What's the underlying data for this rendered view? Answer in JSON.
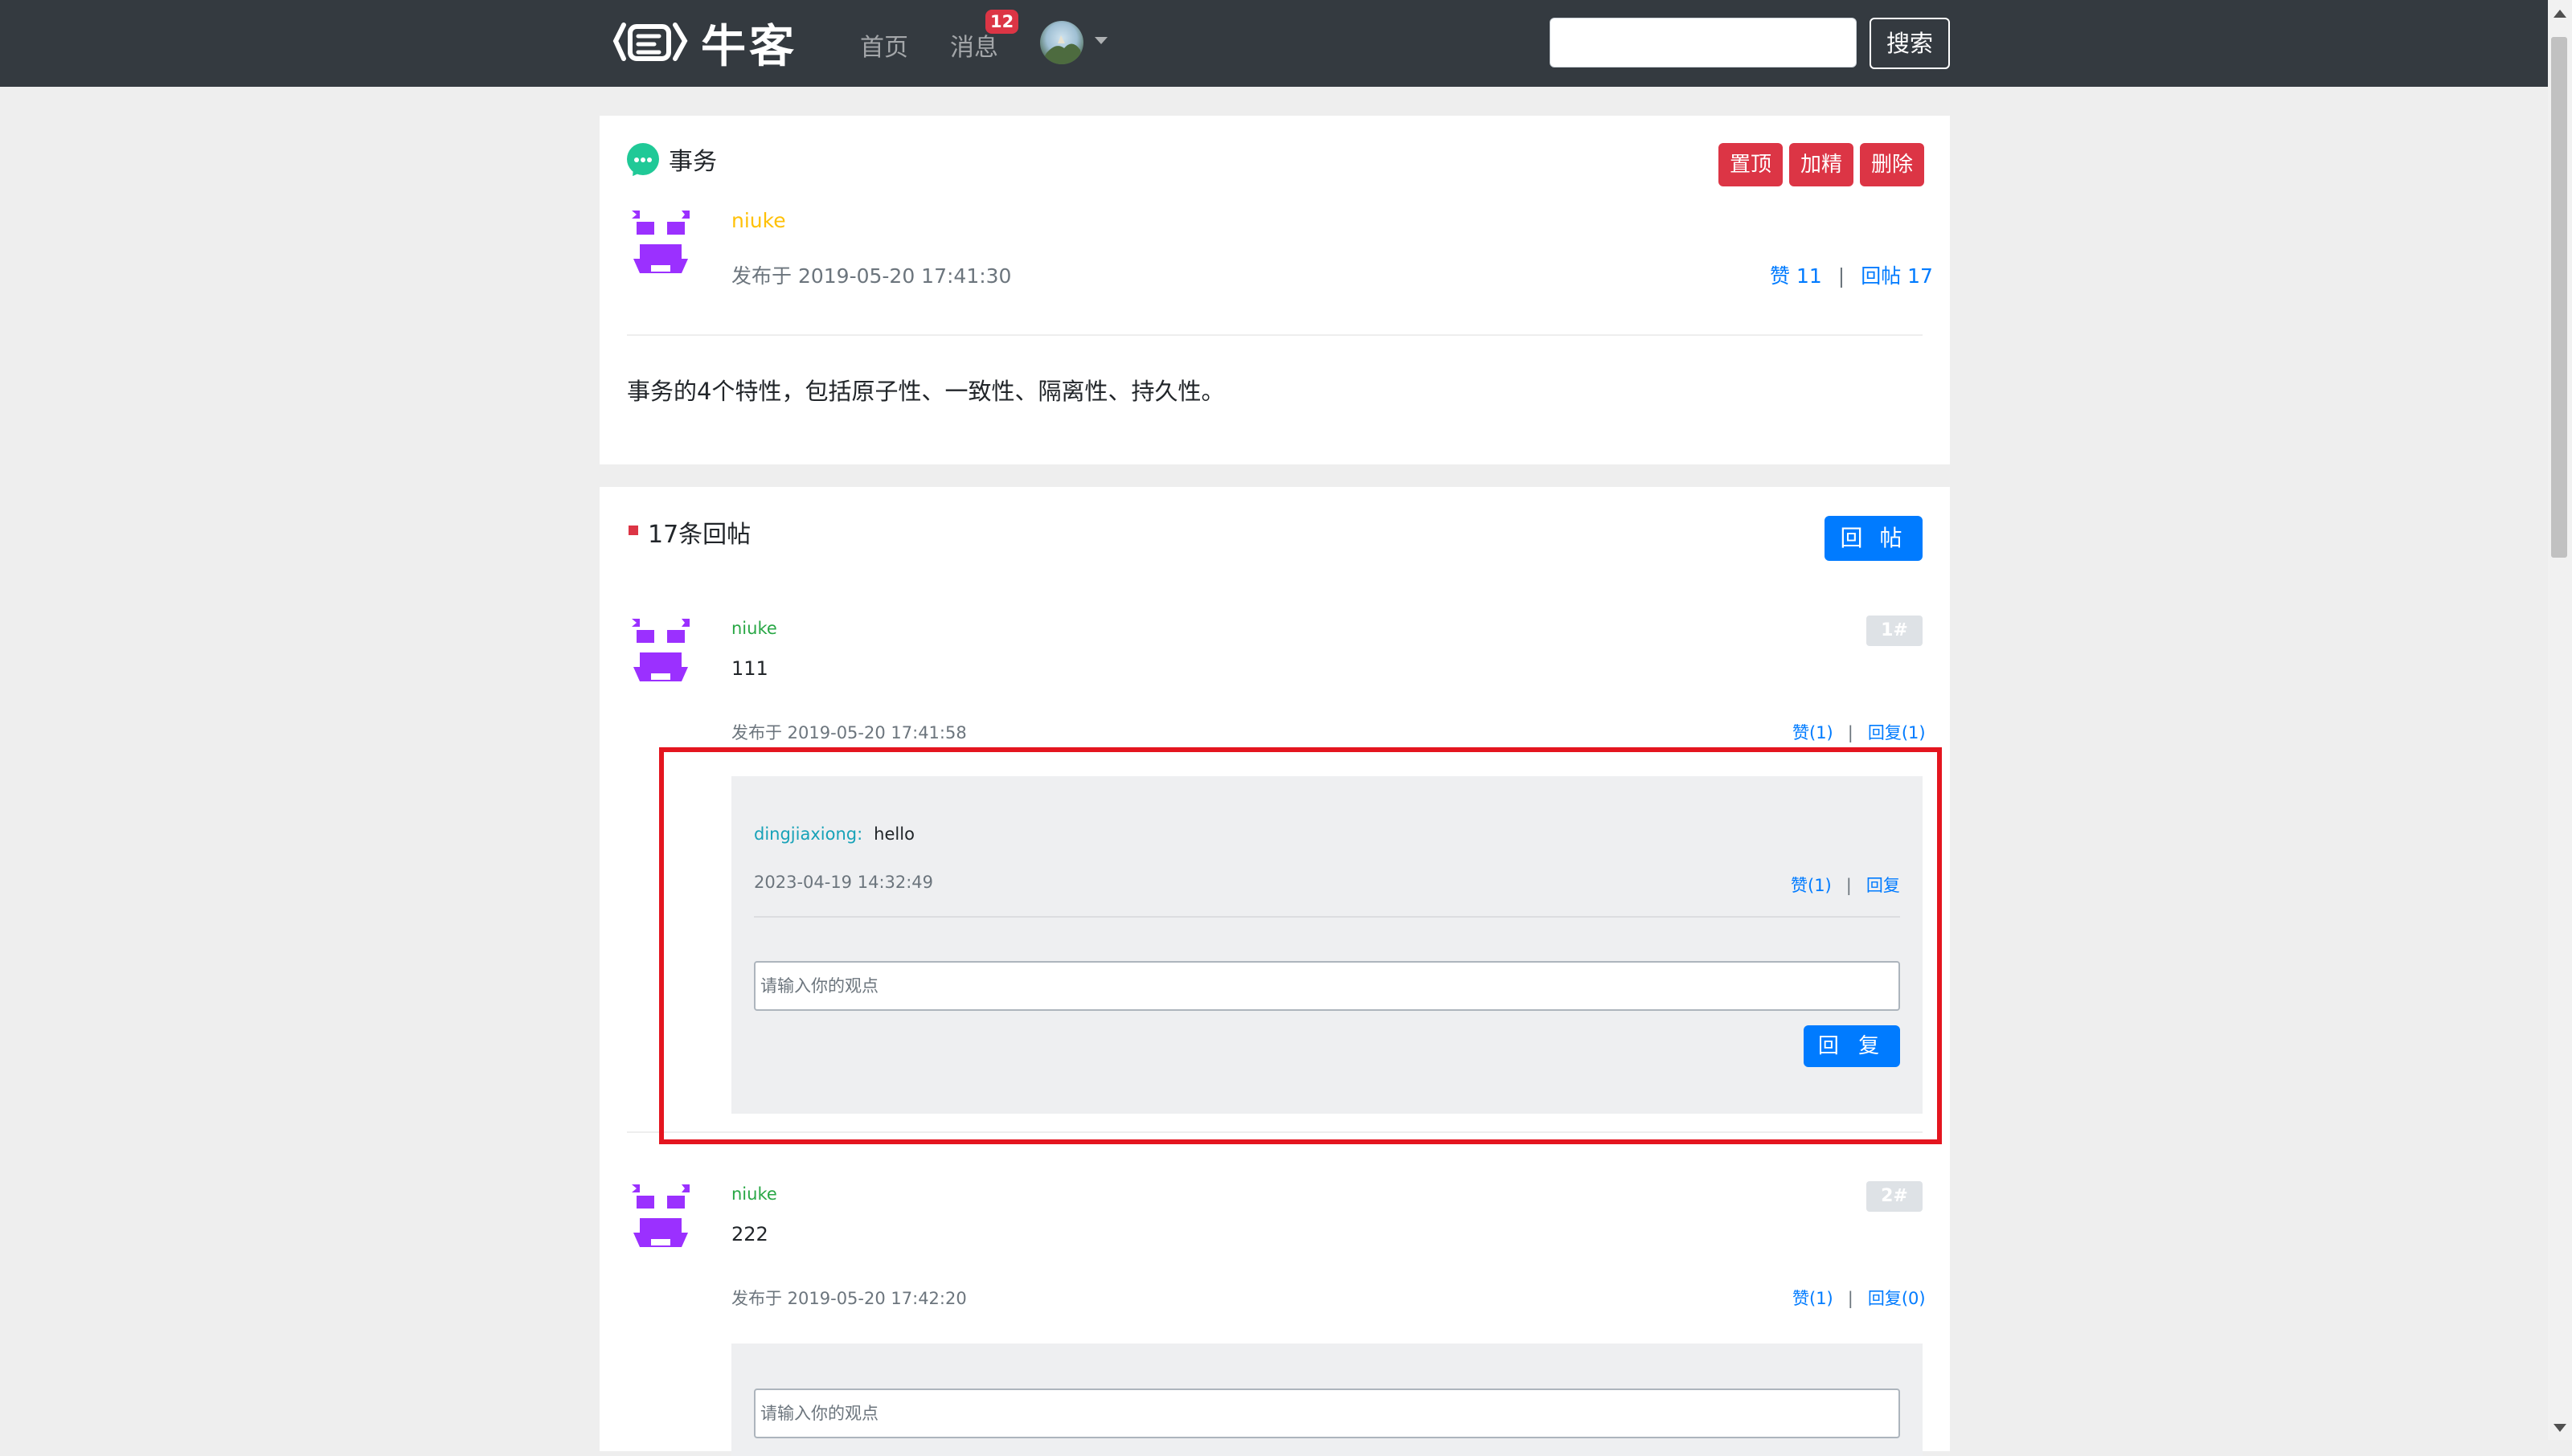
{
  "nav": {
    "logo_text": "牛客",
    "home": "首页",
    "messages": "消息",
    "message_count": "12",
    "search_placeholder": "",
    "search_button": "搜索"
  },
  "post": {
    "title": "事务",
    "actions": {
      "pin": "置顶",
      "highlight": "加精",
      "delete": "删除"
    },
    "author": "niuke",
    "published": "发布于 2019-05-20 17:41:30",
    "likes_label": "赞 11",
    "replies_label": "回帖 17",
    "separator": "|",
    "content": "事务的4个特性，包括原子性、一致性、隔离性、持久性。"
  },
  "replies_section": {
    "count_label": "17条回帖",
    "reply_button": "回 帖",
    "items": [
      {
        "author": "niuke",
        "content": "111",
        "floor": "1#",
        "published": "发布于 2019-05-20 17:41:58",
        "like_label": "赞(1)",
        "reply_label": "回复(1)",
        "comments": [
          {
            "user": "dingjiaxiong:",
            "text": "hello",
            "date": "2023-04-19 14:32:49",
            "like_label": "赞(1)",
            "reply_label": "回复"
          }
        ],
        "input_placeholder": "请输入你的观点",
        "submit_label": "回 复"
      },
      {
        "author": "niuke",
        "content": "222",
        "floor": "2#",
        "published": "发布于 2019-05-20 17:42:20",
        "like_label": "赞(1)",
        "reply_label": "回复(0)",
        "input_placeholder": "请输入你的观点"
      }
    ]
  },
  "colors": {
    "navbar": "#343a40",
    "danger": "#dc3545",
    "primary": "#007bff",
    "success": "#28a745",
    "warning": "#ffc107",
    "info": "#17a2b8",
    "highlight_border": "#e4151f",
    "avatar_purple": "#9b30ff"
  },
  "icons": {
    "logo": "niuke-logo-icon",
    "avatar": "identicon-avatar",
    "post_type": "chat-bubble-icon",
    "dropdown": "caret-down-icon"
  }
}
